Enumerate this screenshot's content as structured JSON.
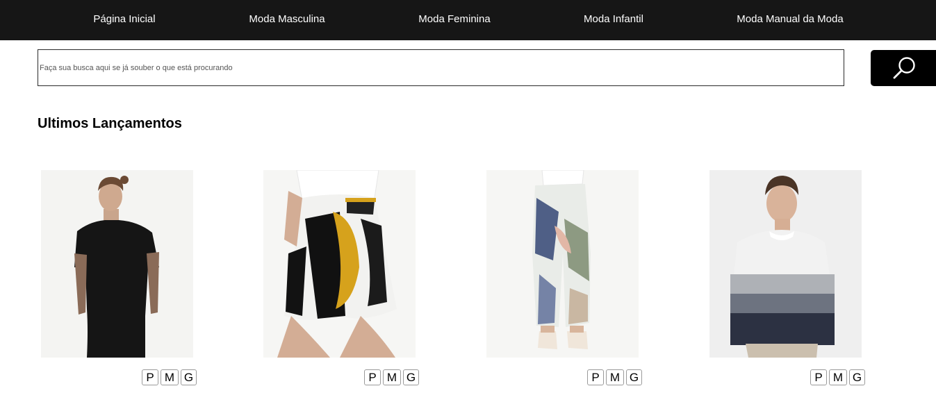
{
  "nav": {
    "items": [
      {
        "label": "Página Inicial"
      },
      {
        "label": "Moda Masculina"
      },
      {
        "label": "Moda Feminina"
      },
      {
        "label": "Moda Infantil"
      },
      {
        "label": "Moda Manual da Moda"
      }
    ]
  },
  "search": {
    "placeholder": "Faça sua busca aqui se já souber o que está procurando",
    "value": "",
    "button_icon": "search-icon"
  },
  "section": {
    "title": "Ultimos Lançamentos"
  },
  "products": [
    {
      "image": "man-black-tshirt",
      "sizes": [
        "P",
        "M",
        "G"
      ]
    },
    {
      "image": "woman-printed-shorts",
      "sizes": [
        "P",
        "M",
        "G"
      ]
    },
    {
      "image": "woman-floral-pants",
      "sizes": [
        "P",
        "M",
        "G"
      ]
    },
    {
      "image": "man-striped-sweater",
      "sizes": [
        "P",
        "M",
        "G"
      ]
    }
  ],
  "colors": {
    "nav_background": "#161616",
    "nav_text": "#ffffff",
    "search_button": "#000000"
  }
}
